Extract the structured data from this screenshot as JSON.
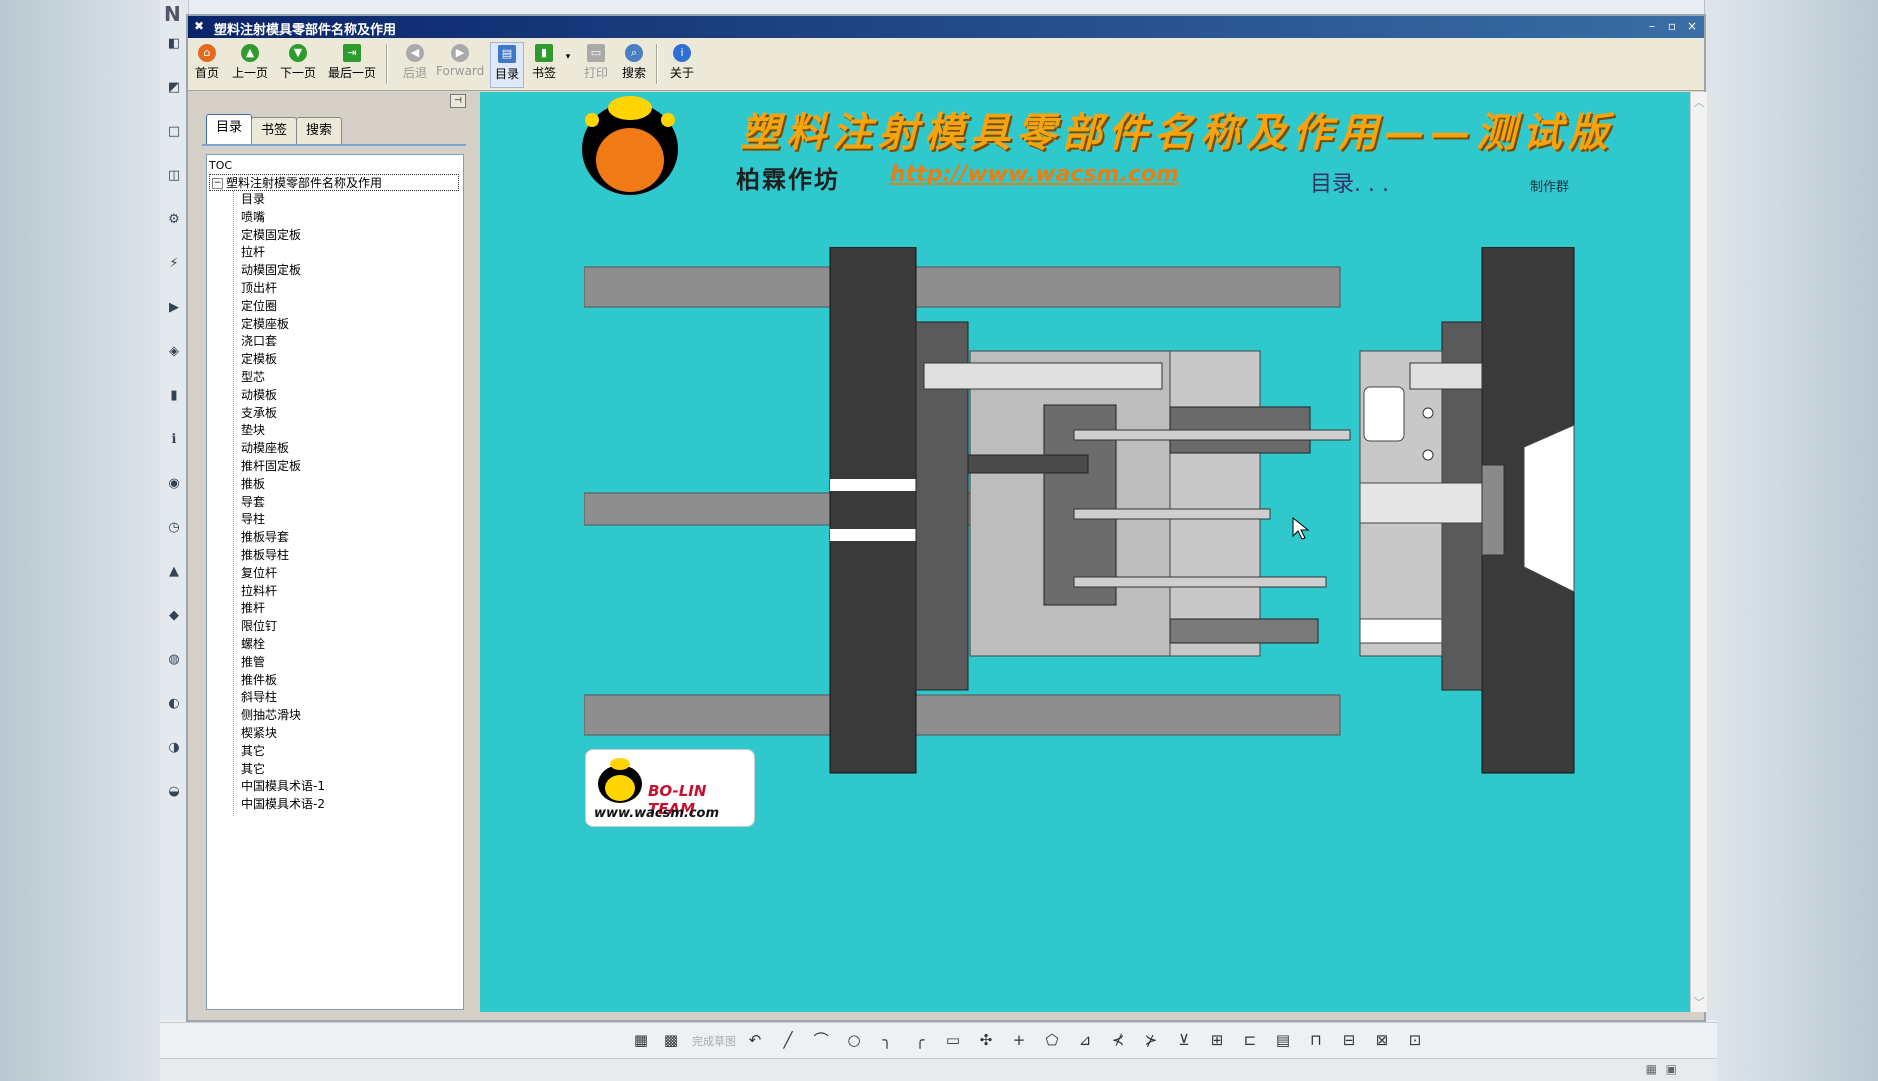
{
  "window": {
    "title": "塑料注射模具零部件名称及作用",
    "minimize": "–",
    "maximize": "▫",
    "close": "×"
  },
  "host": {
    "logo_letter": "N",
    "side_icons": [
      "◧",
      "◩",
      "□",
      "◫",
      "⚙",
      "⚡",
      "▶",
      "◈",
      "▮",
      "ℹ",
      "◉",
      "◷",
      "▲",
      "◆",
      "◍",
      "◐",
      "◑",
      "◒"
    ]
  },
  "toolbar": {
    "home": "首页",
    "prev": "上一页",
    "next": "下一页",
    "last": "最后一页",
    "back": "后退",
    "forward": "Forward",
    "toc": "目录",
    "bookmark": "书签",
    "print": "打印",
    "search": "搜索",
    "about": "关于"
  },
  "nav": {
    "tabs": [
      "目录",
      "书签",
      "搜索"
    ],
    "active_tab": "目录",
    "toc_label": "TOC",
    "root": "塑料注射模零部件名称及作用",
    "items": [
      "目录",
      "喷嘴",
      "定模固定板",
      "拉杆",
      "动模固定板",
      "顶出杆",
      "定位圈",
      "定模座板",
      "浇口套",
      "定模板",
      "型芯",
      "动模板",
      "支承板",
      "垫块",
      "动模座板",
      "推杆固定板",
      "推板",
      "导套",
      "导柱",
      "推板导套",
      "推板导柱",
      "复位杆",
      "拉料杆",
      "推杆",
      "限位钉",
      "螺栓",
      "推管",
      "推件板",
      "斜导柱",
      "侧抽芯滑块",
      "楔紧块",
      "其它",
      "其它",
      "中国模具术语-1",
      "中国模具术语-2"
    ]
  },
  "banner": {
    "title": "塑料注射模具零部件名称及作用——测试版",
    "studio": "柏霖作坊",
    "url": "http://www.wacsm.com",
    "toc_link": "目录. . .",
    "credit": "制作群"
  },
  "badge": {
    "team": "BO-LIN TEAM",
    "url": "www.wacsm.com"
  },
  "bottom_toolbar": {
    "text": "完成草图",
    "icons": [
      "▦",
      "▩",
      "↶",
      "╱",
      "⌒",
      "○",
      "╮",
      "╭",
      "▭",
      "✣",
      "+",
      "⬠",
      "⊿",
      "⊀",
      "⊁",
      "⊻",
      "⊞",
      "⊏",
      "▤",
      "⊓",
      "⊟",
      "⊠",
      "⊡"
    ]
  },
  "colors": {
    "content_bg": "#2fc8cc",
    "title_orange": "#f5a30e",
    "plate_dark": "#3a3a3a",
    "rod_gray": "#8e8e8e"
  }
}
